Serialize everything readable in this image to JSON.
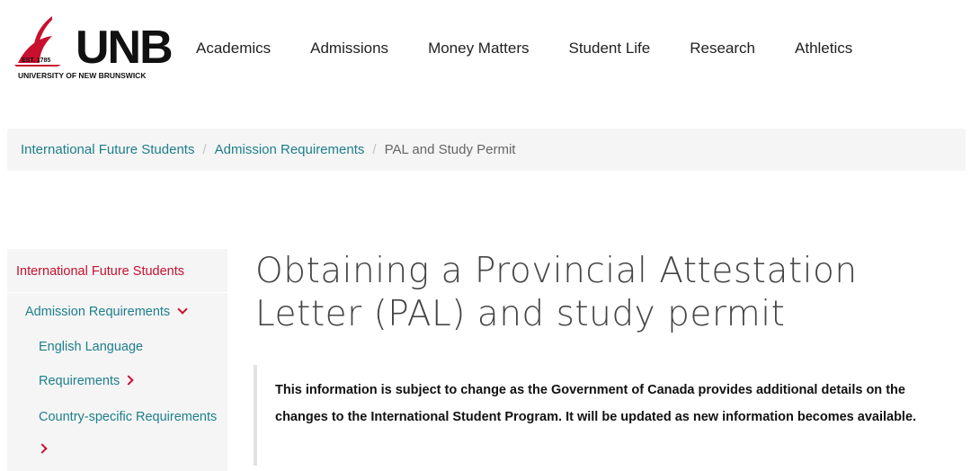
{
  "header": {
    "logo": {
      "text": "UNB",
      "est": "EST. 1785",
      "subtitle": "UNIVERSITY OF NEW BRUNSWICK",
      "accent_color": "#c8102e"
    },
    "nav": [
      {
        "label": "Academics"
      },
      {
        "label": "Admissions"
      },
      {
        "label": "Money Matters"
      },
      {
        "label": "Student Life"
      },
      {
        "label": "Research"
      },
      {
        "label": "Athletics"
      }
    ]
  },
  "breadcrumb": {
    "items": [
      {
        "label": "International Future Students"
      },
      {
        "label": "Admission Requirements"
      }
    ],
    "separator": "/",
    "current": "PAL and Study Permit"
  },
  "sidebar": {
    "top": "International Future Students",
    "level1": {
      "label": "Admission Requirements",
      "icon": "chevron-down-icon"
    },
    "level2": [
      {
        "label_line1": "English Language",
        "label_line2": "Requirements",
        "icon": "chevron-right-icon"
      },
      {
        "label_line1": "Country-specific Requirements",
        "label_line2": "",
        "icon": "chevron-right-icon"
      }
    ]
  },
  "main": {
    "title": "Obtaining a Provincial Attestation Letter (PAL) and study permit",
    "notice": "This information is subject to change as the Government of Canada provides additional details on the changes to the International Student Program. It will be updated as new information becomes available."
  },
  "colors": {
    "link": "#1d7f8c",
    "accent_red": "#c8102e",
    "panel_bg": "#f5f5f5"
  }
}
